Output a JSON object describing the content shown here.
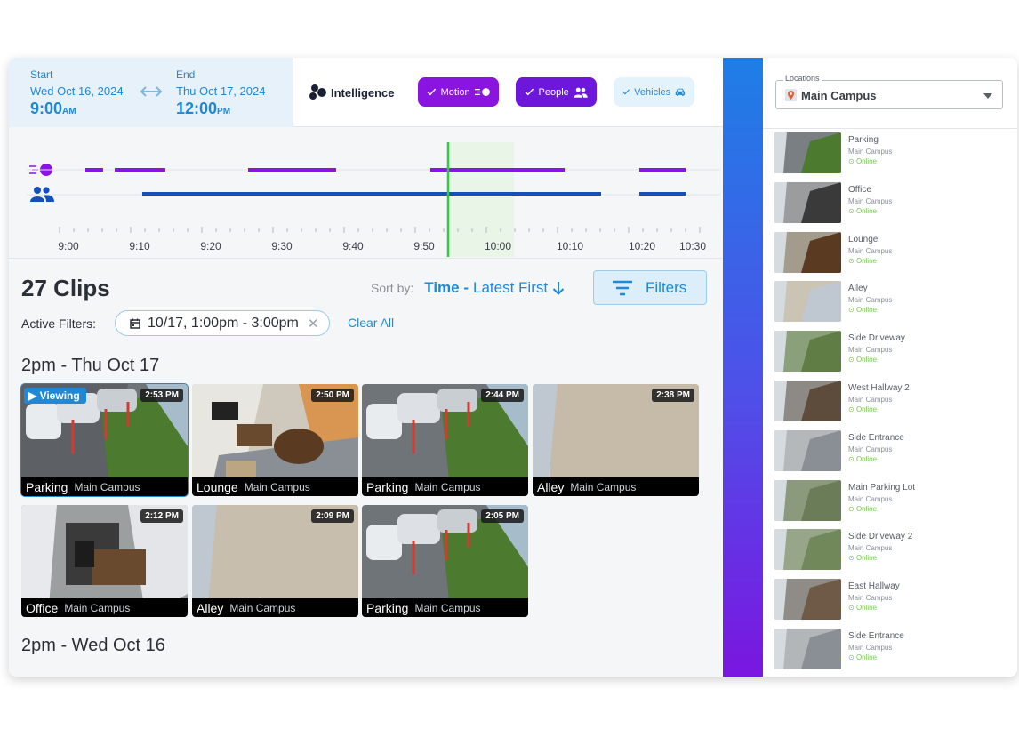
{
  "header": {
    "start": {
      "label": "Start",
      "date": "Wed Oct 16, 2024",
      "time": "9:00",
      "ampm": "AM"
    },
    "end": {
      "label": "End",
      "date": "Thu Oct 17, 2024",
      "time": "12:00",
      "ampm": "PM"
    },
    "intelligence_label": "Intelligence",
    "chips": [
      {
        "label": "Motion",
        "icon": "motion-icon"
      },
      {
        "label": "People",
        "icon": "people-icon"
      },
      {
        "label": "Vehicles",
        "icon": "car-icon"
      }
    ]
  },
  "timeline": {
    "ticks": [
      "9:00",
      "9:10",
      "9:20",
      "9:30",
      "9:40",
      "9:50",
      "10:00",
      "10:10",
      "10:20",
      "10:30"
    ],
    "motion_color": "#8a14e0",
    "people_color": "#1550b8",
    "playhead_color": "#2ecc40"
  },
  "clips": {
    "count_label": "27 Clips",
    "sort_prefix": "Sort by:",
    "sort_field": "Time -",
    "sort_order": "Latest First",
    "filters_label": "Filters",
    "active_filters_label": "Active Filters:",
    "active_filter": "10/17, 1:00pm - 3:00pm",
    "clear_all": "Clear All",
    "groups": [
      {
        "title": "2pm - Thu Oct 17",
        "items": [
          {
            "name": "Parking",
            "site": "Main Campus",
            "time": "2:53 PM",
            "viewing": "Viewing"
          },
          {
            "name": "Lounge",
            "site": "Main Campus",
            "time": "2:50 PM"
          },
          {
            "name": "Parking",
            "site": "Main Campus",
            "time": "2:44 PM"
          },
          {
            "name": "Alley",
            "site": "Main Campus",
            "time": "2:38 PM"
          },
          {
            "name": "Office",
            "site": "Main Campus",
            "time": "2:12 PM"
          },
          {
            "name": "Alley",
            "site": "Main Campus",
            "time": "2:09 PM"
          },
          {
            "name": "Parking",
            "site": "Main Campus",
            "time": "2:05 PM"
          }
        ]
      },
      {
        "title": "2pm - Wed Oct 16",
        "items": []
      }
    ]
  },
  "locations": {
    "legend": "Locations",
    "selected": "Main Campus",
    "cameras": [
      {
        "name": "Parking",
        "site": "Main Campus",
        "status": "Online"
      },
      {
        "name": "Office",
        "site": "Main Campus",
        "status": "Online"
      },
      {
        "name": "Lounge",
        "site": "Main Campus",
        "status": "Online"
      },
      {
        "name": "Alley",
        "site": "Main Campus",
        "status": "Online"
      },
      {
        "name": "Side Driveway",
        "site": "Main Campus",
        "status": "Online"
      },
      {
        "name": "West Hallway 2",
        "site": "Main Campus",
        "status": "Online"
      },
      {
        "name": "Side Entrance",
        "site": "Main Campus",
        "status": "Online"
      },
      {
        "name": "Main Parking Lot",
        "site": "Main Campus",
        "status": "Online"
      },
      {
        "name": "Side Driveway 2",
        "site": "Main Campus",
        "status": "Online"
      },
      {
        "name": "East Hallway",
        "site": "Main Campus",
        "status": "Online"
      },
      {
        "name": "Side Entrance",
        "site": "Main Campus",
        "status": "Online"
      }
    ]
  }
}
